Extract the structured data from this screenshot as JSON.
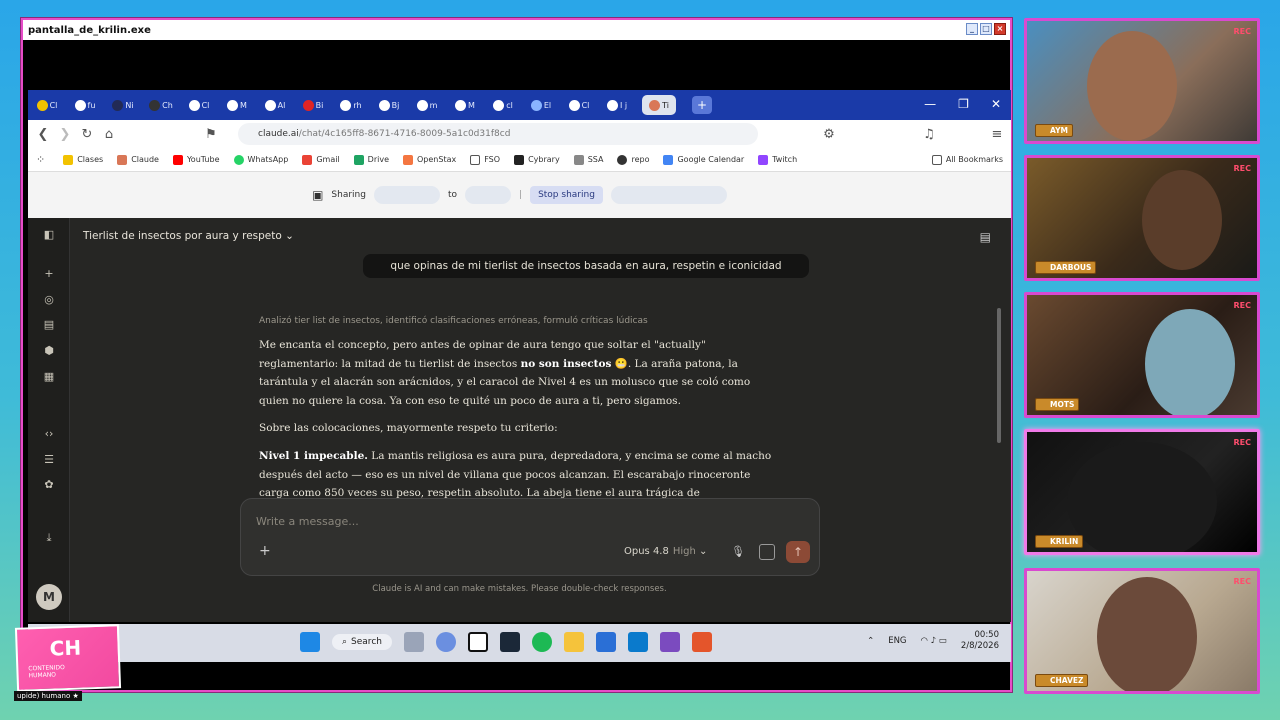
{
  "window": {
    "title": "pantalla_de_krilin.exe"
  },
  "browser": {
    "tabs": [
      "Cl",
      "fu",
      "Ni",
      "Ch",
      "Cl",
      "M",
      "Al",
      "Bi",
      "rh",
      "Bj",
      "m",
      "M",
      "cl",
      "El",
      "Cl",
      "I j",
      "Ti"
    ],
    "url": "claude.ai",
    "url_path": "/chat/4c165ff8-8671-4716-8009-5a1c0d31f8cd",
    "bookmarks": [
      "Clases",
      "Claude",
      "YouTube",
      "WhatsApp",
      "Gmail",
      "Drive",
      "OpenStax",
      "FSO",
      "Cybrary",
      "SSA",
      "repo",
      "Google Calendar",
      "Twitch"
    ],
    "all_bookmarks": "All Bookmarks",
    "sharing_label": "Sharing",
    "to_label": "to",
    "stop_sharing": "Stop sharing"
  },
  "chat": {
    "title": "Tierlist de insectos por aura y respeto",
    "user_message": "que opinas de mi tierlist de insectos basada en aura, respetin e iconicidad",
    "thought_summary": "Analizó tier list de insectos, identificó clasificaciones erróneas, formuló críticas lúdicas",
    "p1_a": "Me encanta el concepto, pero antes de opinar de aura tengo que soltar el \"actually\" reglamentario: la mitad de tu tierlist de insectos ",
    "p1_b": "no son insectos",
    "p1_c": " 😬. La araña patona, la tarántula y el alacrán son arácnidos, y el caracol de Nivel 4 es un molusco que se coló como quien no quiere la cosa. Ya con eso te quité un poco de aura a ti, pero sigamos.",
    "p2": "Sobre las colocaciones, mayormente respeto tu criterio:",
    "p3_a": "Nivel 1 impecable.",
    "p3_b": " La mantis religiosa es aura pura, depredadora, y encima se come al macho después del acto — eso es un nivel de villana que pocos alcanzan. El escarabajo rinoceronte carga como 850 veces su peso, respetin absoluto. La abeja tiene el aura trágica de",
    "input_placeholder": "Write a message...",
    "model": "Opus 4.8",
    "effort": "High",
    "disclaimer": "Claude is AI and can make mistakes. Please double-check responses.",
    "avatar_initial": "M"
  },
  "taskbar": {
    "search": "Search",
    "lang": "ENG",
    "time": "00:50",
    "date": "2/8/2026"
  },
  "cams": [
    {
      "name": "AYM",
      "rec": "REC"
    },
    {
      "name": "DARBOUS",
      "rec": "REC"
    },
    {
      "name": "MOTS",
      "rec": "REC"
    },
    {
      "name": "KRILIN",
      "rec": "REC"
    },
    {
      "name": "CHAVEZ",
      "rec": "REC"
    }
  ],
  "logo": {
    "big": "CH",
    "small_1": "CONTENIDO",
    "small_2": "HUMANO",
    "caption": "upide) humano ★"
  }
}
